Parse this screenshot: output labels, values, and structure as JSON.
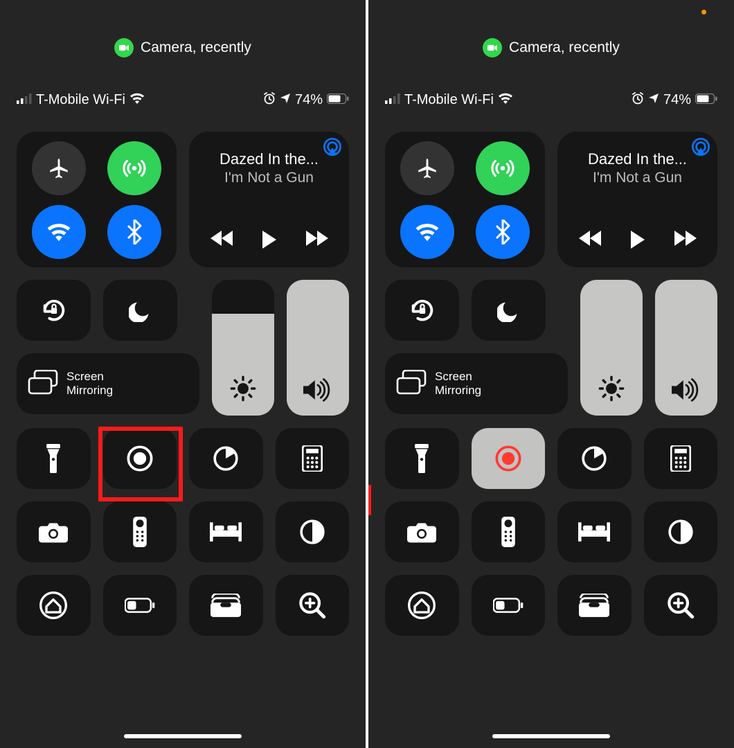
{
  "pill_label": "Camera, recently",
  "carrier": "T-Mobile Wi-Fi",
  "battery_pct": "74%",
  "media": {
    "title": "Dazed In the...",
    "artist": "I'm Not a Gun"
  },
  "screen_mirroring_label": "Screen\nMirroring",
  "left_screen": {
    "brightness_pct": 75,
    "volume_pct": 100,
    "recording_active": false,
    "highlight_record": true
  },
  "right_screen": {
    "brightness_pct": 100,
    "volume_pct": 100,
    "recording_active": true,
    "highlight_record": false,
    "show_orange_dot": true,
    "show_red_mark": true
  }
}
